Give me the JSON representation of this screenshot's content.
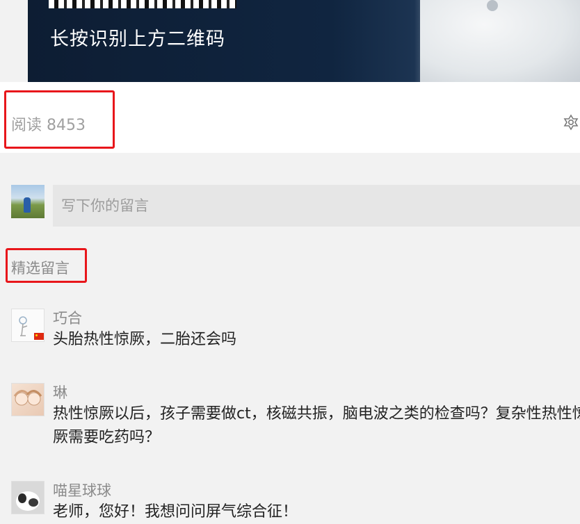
{
  "banner": {
    "caption": "长按识别上方二维码"
  },
  "read_bar": {
    "read_count": "阅读 8453",
    "like_icon": "flower-like-icon"
  },
  "comment_box": {
    "placeholder": "写下你的留言"
  },
  "featured": {
    "title": "精选留言"
  },
  "comments": [
    {
      "name": "巧合",
      "text": "头胎热性惊厥，二胎还会吗"
    },
    {
      "name": "琳",
      "text": "热性惊厥以后，孩子需要做ct，核磁共振，脑电波之类的检查吗？复杂性热性惊厥需要吃药吗？"
    },
    {
      "name": "喵星球球",
      "text": "老师，您好！我想问问屏气综合征！"
    }
  ],
  "colors": {
    "highlight": "#e8161b",
    "muted_text": "#8a8a8a",
    "body_text": "#222222"
  }
}
